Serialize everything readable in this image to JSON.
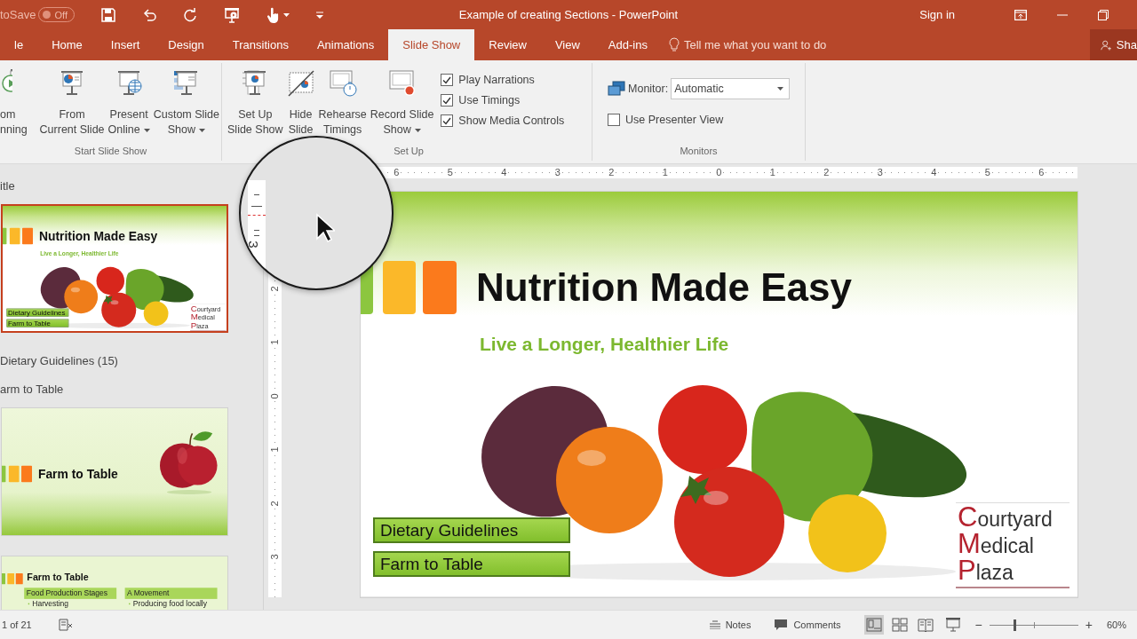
{
  "title_bar": {
    "autosave_label": "toSave",
    "autosave_toggle": {
      "label": "Off",
      "on": false
    },
    "document_title": "Example of creating Sections - PowerPoint",
    "sign_in": "Sign in"
  },
  "tabs": [
    {
      "label": "le",
      "selected": false
    },
    {
      "label": "Home",
      "selected": false
    },
    {
      "label": "Insert",
      "selected": false
    },
    {
      "label": "Design",
      "selected": false
    },
    {
      "label": "Transitions",
      "selected": false
    },
    {
      "label": "Animations",
      "selected": false
    },
    {
      "label": "Slide Show",
      "selected": true
    },
    {
      "label": "Review",
      "selected": false
    },
    {
      "label": "View",
      "selected": false
    },
    {
      "label": "Add-ins",
      "selected": false
    }
  ],
  "tell_me": "Tell me what you want to do",
  "share": "Sha",
  "ribbon": {
    "groups": [
      {
        "label": "Start Slide Show",
        "buttons": [
          {
            "lines": [
              "om",
              "nning"
            ],
            "dropdown": false
          },
          {
            "lines": [
              "From",
              "Current Slide"
            ],
            "dropdown": false
          },
          {
            "lines": [
              "Present",
              "Online"
            ],
            "dropdown": true
          },
          {
            "lines": [
              "Custom Slide",
              "Show"
            ],
            "dropdown": true
          }
        ]
      },
      {
        "label": "Set Up",
        "buttons": [
          {
            "lines": [
              "Set Up",
              "Slide Show"
            ],
            "dropdown": false
          },
          {
            "lines": [
              "Hide",
              "Slide"
            ],
            "dropdown": false
          },
          {
            "lines": [
              "Rehearse",
              "Timings"
            ],
            "dropdown": false
          },
          {
            "lines": [
              "Record Slide",
              "Show"
            ],
            "dropdown": true
          }
        ],
        "checkboxes": [
          {
            "label": "Play Narrations",
            "checked": true
          },
          {
            "label": "Use Timings",
            "checked": true
          },
          {
            "label": "Show Media Controls",
            "checked": true
          }
        ]
      },
      {
        "label": "Monitors",
        "monitor": {
          "label": "Monitor:",
          "value": "Automatic"
        },
        "checkboxes": [
          {
            "label": "Use Presenter View",
            "checked": false
          }
        ]
      }
    ]
  },
  "slides_pane": {
    "sections": [
      {
        "label": "itle",
        "slides": [
          {
            "kind": "title",
            "selected": true,
            "title": "Nutrition Made Easy",
            "subtitle": "Live a Longer, Healthier Life",
            "links": [
              "Dietary Guidelines",
              "Farm to Table"
            ],
            "logo": [
              "Courtyard",
              "Medical",
              "Plaza"
            ]
          }
        ]
      },
      {
        "label": "Dietary Guidelines (15)"
      },
      {
        "label": "arm to Table",
        "slides": [
          {
            "kind": "section",
            "selected": false,
            "title": "Farm to Table"
          },
          {
            "kind": "content",
            "selected": false,
            "title": "Farm to Table",
            "columns": [
              {
                "heading": "Food Production Stages",
                "bullets": [
                  "Harvesting"
                ]
              },
              {
                "heading": "A Movement",
                "bullets": [
                  "Producing food locally"
                ]
              }
            ]
          }
        ]
      }
    ]
  },
  "editor": {
    "h_ruler": [
      "6",
      "5",
      "4",
      "3",
      "2",
      "1",
      "0",
      "1",
      "2",
      "3",
      "4",
      "5",
      "6"
    ],
    "v_ruler": [
      "2",
      "1",
      "0",
      "1",
      "2",
      "3"
    ],
    "slide": {
      "kind": "title",
      "title": "Nutrition Made Easy",
      "subtitle": "Live a Longer, Healthier Life",
      "links": [
        "Dietary Guidelines",
        "Farm to Table"
      ],
      "logo": [
        "Courtyard",
        "Medical",
        "Plaza"
      ]
    }
  },
  "magnifier": {
    "ruler_label": "3"
  },
  "status_bar": {
    "slide_counter": "1 of 21",
    "notes": "Notes",
    "comments": "Comments",
    "views": [
      {
        "selected": true
      },
      {
        "selected": false
      },
      {
        "selected": false
      }
    ],
    "zoom_out": "−",
    "zoom_in": "+",
    "zoom": {
      "level": 0.28
    },
    "zoom_percent": "60%"
  }
}
